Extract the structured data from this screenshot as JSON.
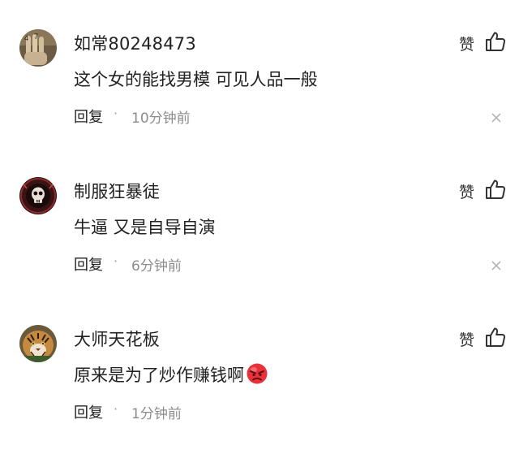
{
  "comments": [
    {
      "username": "如常80248473",
      "text": "这个女的能找男模 可见人品一般",
      "reply_label": "回复",
      "separator": "·",
      "time": "10分钟前",
      "like_label": "赞",
      "avatar_icon": "fingers-photo-avatar",
      "emoji": null
    },
    {
      "username": "制服狂暴徒",
      "text": "牛逼 又是自导自演",
      "reply_label": "回复",
      "separator": "·",
      "time": "6分钟前",
      "like_label": "赞",
      "avatar_icon": "skull-emblem-avatar",
      "emoji": null
    },
    {
      "username": "大师天花板",
      "text": "原来是为了炒作赚钱啊",
      "reply_label": "回复",
      "separator": "·",
      "time": "1分钟前",
      "like_label": "赞",
      "avatar_icon": "tiger-photo-avatar",
      "emoji": "angry-face-emoji"
    }
  ],
  "colors": {
    "text_primary": "#222222",
    "text_secondary": "#8c8c8c",
    "icon": "#333333",
    "emoji_red": "#e8313a"
  }
}
